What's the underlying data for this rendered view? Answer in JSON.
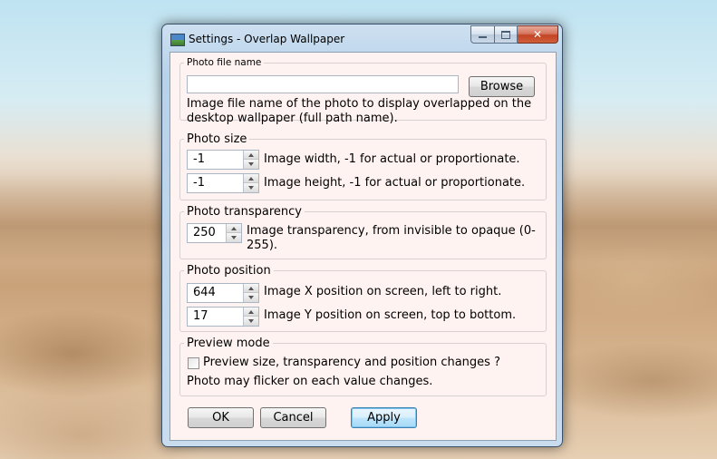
{
  "window": {
    "title": "Settings - Overlap Wallpaper",
    "close_symbol": "✕"
  },
  "photo_file": {
    "legend": "Photo file name",
    "input_value": "",
    "browse_label": "Browse",
    "description": "Image file name of the photo to display overlapped on the desktop wallpaper (full path name)."
  },
  "photo_size": {
    "legend": "Photo size",
    "width_value": "-1",
    "width_desc": "Image width, -1 for actual or proportionate.",
    "height_value": "-1",
    "height_desc": "Image height, -1 for actual or proportionate."
  },
  "photo_transparency": {
    "legend": "Photo transparency",
    "value": "250",
    "desc": "Image transparency, from invisible to opaque (0-255)."
  },
  "photo_position": {
    "legend": "Photo position",
    "x_value": "644",
    "x_desc": "Image X position on screen, left to right.",
    "y_value": "17",
    "y_desc": "Image Y position on screen, top to bottom."
  },
  "preview_mode": {
    "legend": "Preview mode",
    "checkbox_label": "Preview size, transparency and position changes ?",
    "checked": false,
    "note": "Photo may flicker on each value changes."
  },
  "buttons": {
    "ok": "OK",
    "cancel": "Cancel",
    "apply": "Apply"
  }
}
